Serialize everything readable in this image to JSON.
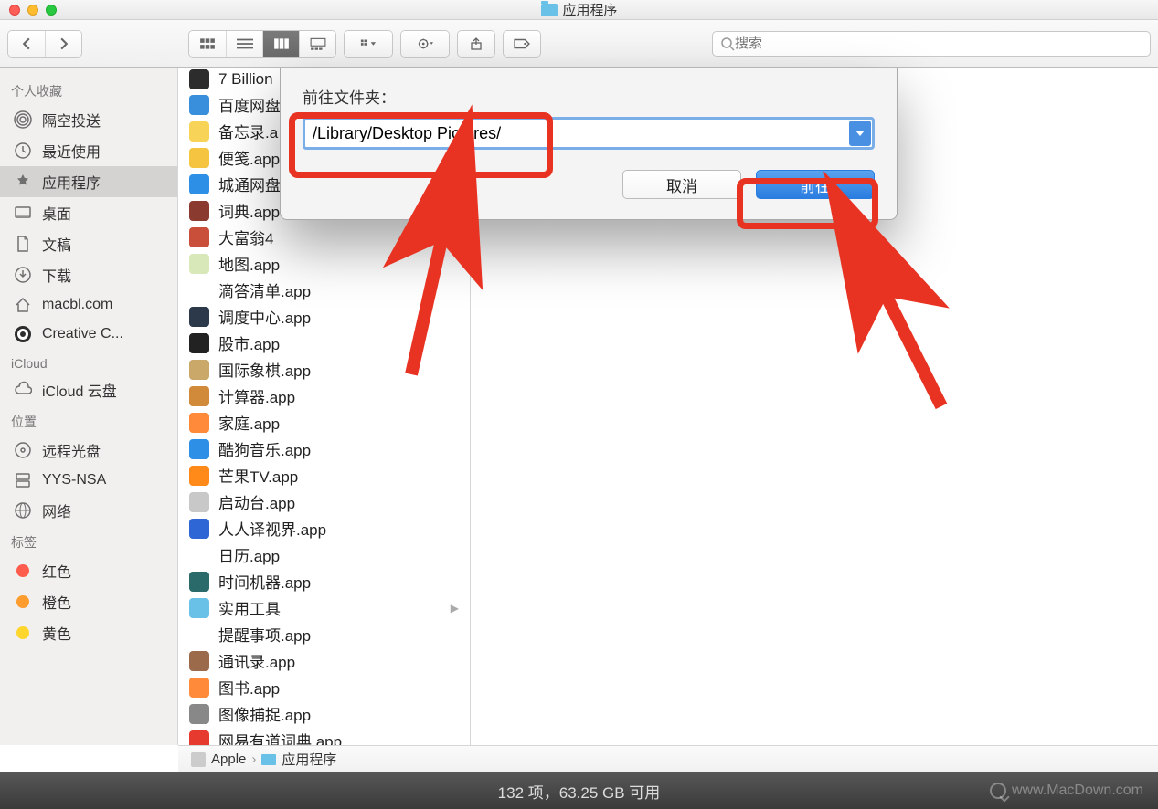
{
  "window": {
    "title": "应用程序"
  },
  "toolbar": {
    "search_placeholder": "搜索"
  },
  "sidebar": {
    "sections": [
      {
        "header": "个人收藏",
        "items": [
          {
            "label": "隔空投送",
            "icon": "airdrop"
          },
          {
            "label": "最近使用",
            "icon": "clock"
          },
          {
            "label": "应用程序",
            "icon": "apps",
            "selected": true
          },
          {
            "label": "桌面",
            "icon": "desktop"
          },
          {
            "label": "文稿",
            "icon": "doc"
          },
          {
            "label": "下载",
            "icon": "download"
          },
          {
            "label": "macbl.com",
            "icon": "home"
          },
          {
            "label": "Creative C...",
            "icon": "cc"
          }
        ]
      },
      {
        "header": "iCloud",
        "items": [
          {
            "label": "iCloud 云盘",
            "icon": "cloud"
          }
        ]
      },
      {
        "header": "位置",
        "items": [
          {
            "label": "远程光盘",
            "icon": "disc"
          },
          {
            "label": "YYS-NSA",
            "icon": "server"
          },
          {
            "label": "网络",
            "icon": "globe"
          }
        ]
      },
      {
        "header": "标签",
        "items": [
          {
            "label": "红色",
            "icon": "tag",
            "color": "#ff5c4d"
          },
          {
            "label": "橙色",
            "icon": "tag",
            "color": "#ff9c2e"
          },
          {
            "label": "黄色",
            "icon": "tag",
            "color": "#ffd62e"
          }
        ]
      }
    ]
  },
  "files": [
    {
      "name": "7 Billion",
      "bg": "#2c2c2c"
    },
    {
      "name": "百度网盘",
      "bg": "#3a8fdc"
    },
    {
      "name": "备忘录.a",
      "bg": "#f7d358"
    },
    {
      "name": "便笺.app",
      "bg": "#f5c542"
    },
    {
      "name": "城通网盘",
      "bg": "#2e8fe6"
    },
    {
      "name": "词典.app",
      "bg": "#8a3a2e"
    },
    {
      "name": "大富翁4",
      "bg": "#c94f3a"
    },
    {
      "name": "地图.app",
      "bg": "#d8e8b8"
    },
    {
      "name": "滴答清单.app",
      "bg": "#ffffff"
    },
    {
      "name": "调度中心.app",
      "bg": "#2c394a"
    },
    {
      "name": "股市.app",
      "bg": "#222"
    },
    {
      "name": "国际象棋.app",
      "bg": "#c9a86a"
    },
    {
      "name": "计算器.app",
      "bg": "#d08a3a"
    },
    {
      "name": "家庭.app",
      "bg": "#ff8a3a"
    },
    {
      "name": "酷狗音乐.app",
      "bg": "#2e8fe6"
    },
    {
      "name": "芒果TV.app",
      "bg": "#ff8a1a"
    },
    {
      "name": "启动台.app",
      "bg": "#c8c8c8"
    },
    {
      "name": "人人译视界.app",
      "bg": "#2e66d6"
    },
    {
      "name": "日历.app",
      "bg": "#fff"
    },
    {
      "name": "时间机器.app",
      "bg": "#2a6a6a"
    },
    {
      "name": "实用工具",
      "bg": "#6ac1e8",
      "folder": true
    },
    {
      "name": "提醒事项.app",
      "bg": "#fff"
    },
    {
      "name": "通讯录.app",
      "bg": "#9a6a4a"
    },
    {
      "name": "图书.app",
      "bg": "#ff8a3a"
    },
    {
      "name": "图像捕捉.app",
      "bg": "#888"
    },
    {
      "name": "网易有道词典.app",
      "bg": "#e63a2e"
    }
  ],
  "dialog": {
    "label": "前往文件夹：",
    "path": "/Library/Desktop Pictures/",
    "cancel": "取消",
    "go": "前往"
  },
  "pathbar": {
    "disk": "Apple",
    "folder": "应用程序"
  },
  "status": {
    "text": "132 项，63.25 GB 可用"
  },
  "watermark": "www.MacDown.com"
}
